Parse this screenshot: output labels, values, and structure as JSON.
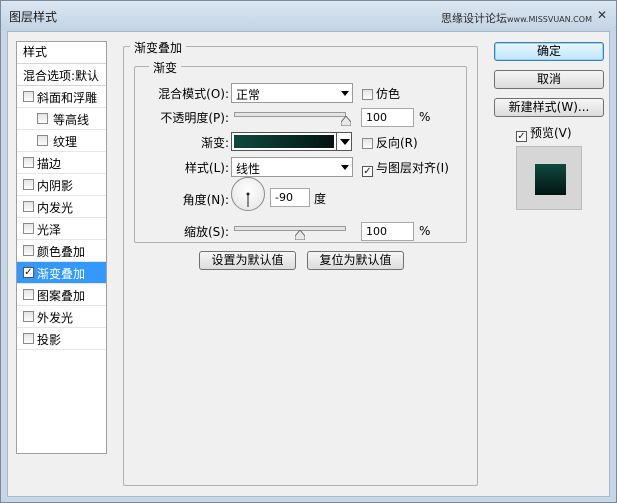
{
  "window": {
    "title": "图层样式",
    "watermark_main": "思缘设计论坛",
    "watermark_small": "www.MISSVUAN.COM",
    "close_glyph": "✕"
  },
  "stylelist": {
    "header": "样式",
    "blend_options": "混合选项:默认",
    "items": [
      {
        "label": "斜面和浮雕",
        "checked": false,
        "indent": false
      },
      {
        "label": "等高线",
        "checked": false,
        "indent": true
      },
      {
        "label": "纹理",
        "checked": false,
        "indent": true
      },
      {
        "label": "描边",
        "checked": false,
        "indent": false
      },
      {
        "label": "内阴影",
        "checked": false,
        "indent": false
      },
      {
        "label": "内发光",
        "checked": false,
        "indent": false
      },
      {
        "label": "光泽",
        "checked": false,
        "indent": false
      },
      {
        "label": "颜色叠加",
        "checked": false,
        "indent": false
      },
      {
        "label": "渐变叠加",
        "checked": true,
        "indent": false,
        "active": true
      },
      {
        "label": "图案叠加",
        "checked": false,
        "indent": false
      },
      {
        "label": "外发光",
        "checked": false,
        "indent": false
      },
      {
        "label": "投影",
        "checked": false,
        "indent": false
      }
    ]
  },
  "panel": {
    "outer_legend": "渐变叠加",
    "inner_legend": "渐变",
    "blend_mode_label": "混合模式(O):",
    "blend_mode_value": "正常",
    "dither_label": "仿色",
    "dither_checked": false,
    "opacity_label": "不透明度(P):",
    "opacity_value": "100",
    "opacity_unit": "%",
    "opacity_level": 1.0,
    "gradient_label": "渐变:",
    "reverse_label": "反向(R)",
    "reverse_checked": false,
    "style_label": "样式(L):",
    "style_value": "线性",
    "align_label": "与图层对齐(I)",
    "align_checked": true,
    "angle_label": "角度(N):",
    "angle_value": "-90",
    "angle_unit": "度",
    "scale_label": "缩放(S):",
    "scale_value": "100",
    "scale_unit": "%",
    "scale_level": 0.59,
    "make_default_label": "设置为默认值",
    "reset_default_label": "复位为默认值"
  },
  "gradient_colors": {
    "start": "#0d4a3e",
    "end": "#041410"
  },
  "actions": {
    "ok_label": "确定",
    "cancel_label": "取消",
    "new_style_label": "新建样式(W)...",
    "preview_label": "预览(V)",
    "preview_checked": true
  }
}
